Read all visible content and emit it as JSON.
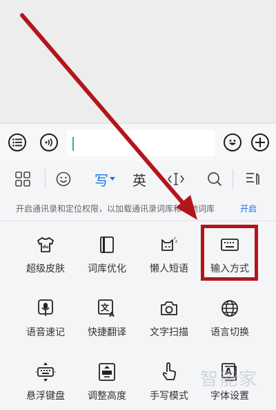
{
  "input_bar": {
    "text_value": ""
  },
  "toolbar": {
    "write_label": "写",
    "english_label": "英"
  },
  "notice": {
    "text": "开启通讯录和定位权限，以加载通讯录词库和本地词库",
    "action": "开启"
  },
  "grid": {
    "items": [
      {
        "label": "超级皮肤",
        "icon": "tshirt-icon"
      },
      {
        "label": "词库优化",
        "icon": "book-icon"
      },
      {
        "label": "懒人短语",
        "icon": "lazy-cat-icon"
      },
      {
        "label": "输入方式",
        "icon": "keyboard-icon"
      },
      {
        "label": "语音速记",
        "icon": "microphone-icon"
      },
      {
        "label": "快捷翻译",
        "icon": "translate-icon"
      },
      {
        "label": "文字扫描",
        "icon": "camera-icon"
      },
      {
        "label": "语言切换",
        "icon": "globe-icon"
      },
      {
        "label": "悬浮键盘",
        "icon": "floating-keyboard-icon"
      },
      {
        "label": "调整高度",
        "icon": "adjust-height-icon"
      },
      {
        "label": "手写模式",
        "icon": "handwriting-icon"
      },
      {
        "label": "字体设置",
        "icon": "font-icon"
      }
    ]
  },
  "watermark": {
    "text": "智能家"
  },
  "colors": {
    "accent": "#1a73e8",
    "annotation_red": "#b2161a",
    "cursor_green": "#19c26b"
  }
}
